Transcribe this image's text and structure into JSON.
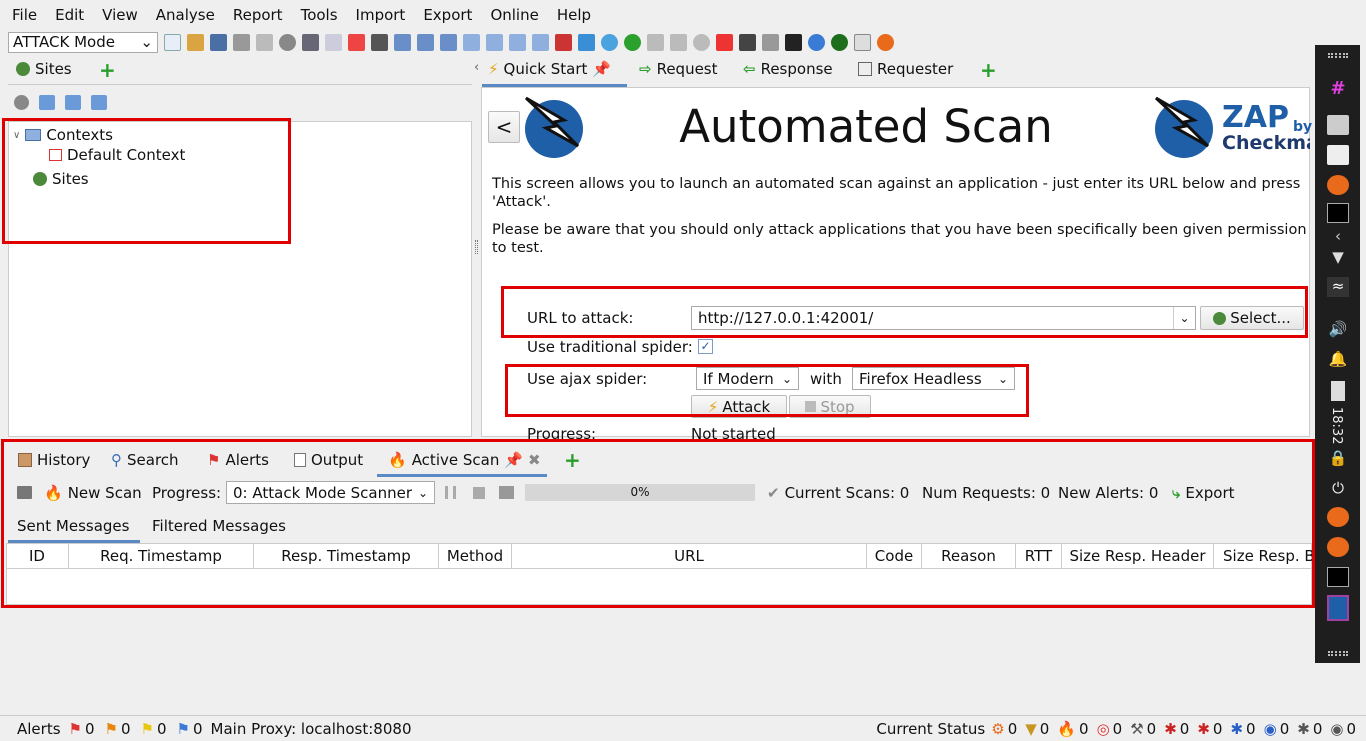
{
  "menu": [
    "File",
    "Edit",
    "View",
    "Analyse",
    "Report",
    "Tools",
    "Import",
    "Export",
    "Online",
    "Help"
  ],
  "toolbar": {
    "mode": "ATTACK Mode"
  },
  "left": {
    "tab_sites": "Sites",
    "tree": {
      "contexts": "Contexts",
      "default_context": "Default Context",
      "sites": "Sites"
    }
  },
  "right": {
    "tabs": {
      "quick_start": "Quick Start",
      "request": "Request",
      "response": "Response",
      "requester": "Requester"
    },
    "back": "<",
    "title": "Automated Scan",
    "logo": {
      "zap": "ZAP",
      "by": "by",
      "checkmarx": "Checkmarx"
    },
    "intro": "This screen allows you to launch an automated scan against  an application - just enter its URL below and press 'Attack'.",
    "warning": "Please be aware that you should only attack applications that you have been specifically been given permission to test.",
    "url_label": "URL to attack:",
    "url_value": "http://127.0.0.1:42001/",
    "select_btn": "Select...",
    "trad_spider_label": "Use traditional spider:",
    "ajax_label": "Use ajax spider:",
    "ajax_mode": "If Modern",
    "with": "with",
    "browser": "Firefox Headless",
    "attack_btn": "Attack",
    "stop_btn": "Stop",
    "progress_label": "Progress:",
    "progress_value": "Not started"
  },
  "bottom": {
    "tabs": {
      "history": "History",
      "search": "Search",
      "alerts": "Alerts",
      "output": "Output",
      "active_scan": "Active Scan"
    },
    "new_scan": "New Scan",
    "progress_label": "Progress:",
    "progress_select": "0: Attack Mode Scanner",
    "progress_pct": "0%",
    "progress_fraction": 0,
    "current_scans": "Current Scans: 0",
    "num_requests": "Num Requests: 0",
    "new_alerts": "New Alerts: 0",
    "export": "Export",
    "subtabs": {
      "sent": "Sent Messages",
      "filtered": "Filtered Messages"
    },
    "columns": [
      "ID",
      "Req. Timestamp",
      "Resp. Timestamp",
      "Method",
      "URL",
      "Code",
      "Reason",
      "RTT",
      "Size Resp. Header",
      "Size Resp. Body"
    ]
  },
  "statusbar": {
    "alerts_label": "Alerts",
    "alert_counts": [
      "0",
      "0",
      "0",
      "0"
    ],
    "proxy": "Main Proxy: localhost:8080",
    "current_status": "Current Status",
    "status_counts": [
      "0",
      "0",
      "0",
      "0",
      "0",
      "0",
      "0",
      "0",
      "0",
      "0"
    ]
  },
  "taskbar": {
    "clock": "18:32"
  }
}
